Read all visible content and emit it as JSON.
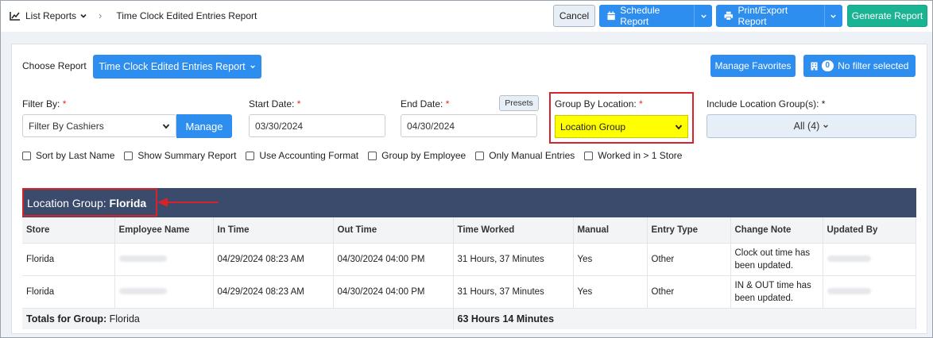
{
  "topbar": {
    "list_reports": "List Reports",
    "breadcrumb_current": "Time Clock Edited Entries Report",
    "cancel": "Cancel",
    "schedule": "Schedule Report",
    "print": "Print/Export Report",
    "generate": "Generate Report"
  },
  "choose": {
    "label": "Choose Report",
    "selected": "Time Clock Edited Entries Report",
    "manage_favorites": "Manage Favorites",
    "filter_count": "0",
    "filter_text": "No filter selected"
  },
  "filters": {
    "filter_by_label": "Filter By:",
    "filter_by_value": "Filter By Cashiers",
    "manage": "Manage",
    "start_label": "Start Date:",
    "start_value": "03/30/2024",
    "end_label": "End Date:",
    "end_value": "04/30/2024",
    "presets": "Presets",
    "group_by_label": "Group By Location:",
    "group_by_value": "Location Group",
    "include_label": "Include Location Group(s):",
    "include_value": "All (4)",
    "required_mark": "*"
  },
  "checkboxes": [
    "Sort by Last Name",
    "Show Summary Report",
    "Use Accounting Format",
    "Group by Employee",
    "Only Manual Entries",
    "Worked in > 1 Store"
  ],
  "group": {
    "prefix": "Location Group:",
    "name": "Florida"
  },
  "table": {
    "headers": [
      "Store",
      "Employee Name",
      "In Time",
      "Out Time",
      "Time Worked",
      "Manual",
      "Entry Type",
      "Change Note",
      "Updated By"
    ],
    "rows": [
      {
        "store": "Florida",
        "in": "04/29/2024 08:23 AM",
        "out": "04/30/2024 04:00 PM",
        "worked": "31 Hours, 37 Minutes",
        "manual": "Yes",
        "entry": "Other",
        "note": "Clock out time has been updated."
      },
      {
        "store": "Florida",
        "in": "04/29/2024 08:23 AM",
        "out": "04/30/2024 04:00 PM",
        "worked": "31 Hours, 37 Minutes",
        "manual": "Yes",
        "entry": "Other",
        "note": "IN & OUT time has been updated."
      }
    ],
    "totals_label": "Totals for Group:",
    "totals_group": "Florida",
    "totals_value": "63 Hours 14 Minutes"
  },
  "colors": {
    "primary": "#2d8ef0",
    "teal": "#1ab394",
    "header": "#3b4b6b",
    "highlight": "#ffff00",
    "annotation": "#d6232a"
  }
}
